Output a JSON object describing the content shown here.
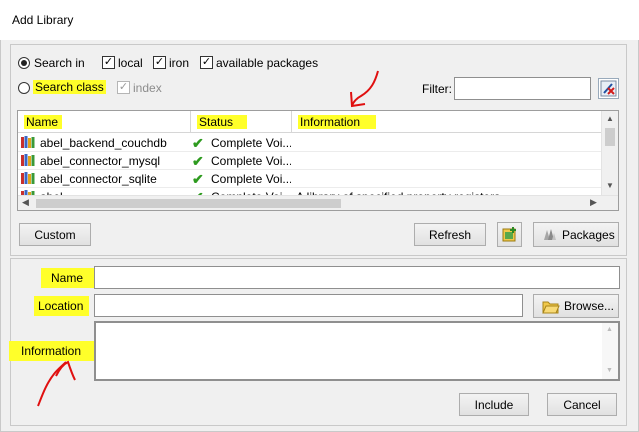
{
  "window": {
    "title": "Add Library"
  },
  "search": {
    "search_in_label": "Search in",
    "search_class_label": "Search class",
    "local_label": "local",
    "iron_label": "iron",
    "available_packages_label": "available packages",
    "index_label": "index",
    "filter_label": "Filter:",
    "filter_value": ""
  },
  "table": {
    "columns": [
      "Name",
      "Status",
      "Information"
    ],
    "rows": [
      {
        "name": "abel_backend_couchdb",
        "status": "Complete Voi...",
        "info": ""
      },
      {
        "name": "abel_connector_mysql",
        "status": "Complete Voi...",
        "info": ""
      },
      {
        "name": "abel_connector_sqlite",
        "status": "Complete Voi...",
        "info": ""
      },
      {
        "name": "abel...",
        "status": "Complete Voi...",
        "info": "A library of specified property registers ..."
      }
    ]
  },
  "buttons": {
    "custom": "Custom",
    "refresh": "Refresh",
    "packages": "Packages",
    "browse": "Browse...",
    "include": "Include",
    "cancel": "Cancel"
  },
  "form": {
    "name_label": "Name",
    "name_value": "",
    "location_label": "Location",
    "location_value": "",
    "information_label": "Information",
    "information_value": ""
  },
  "colors": {
    "highlight": "#ffff2a",
    "annotation": "#e01010",
    "check_green": "#2e9b1f"
  }
}
